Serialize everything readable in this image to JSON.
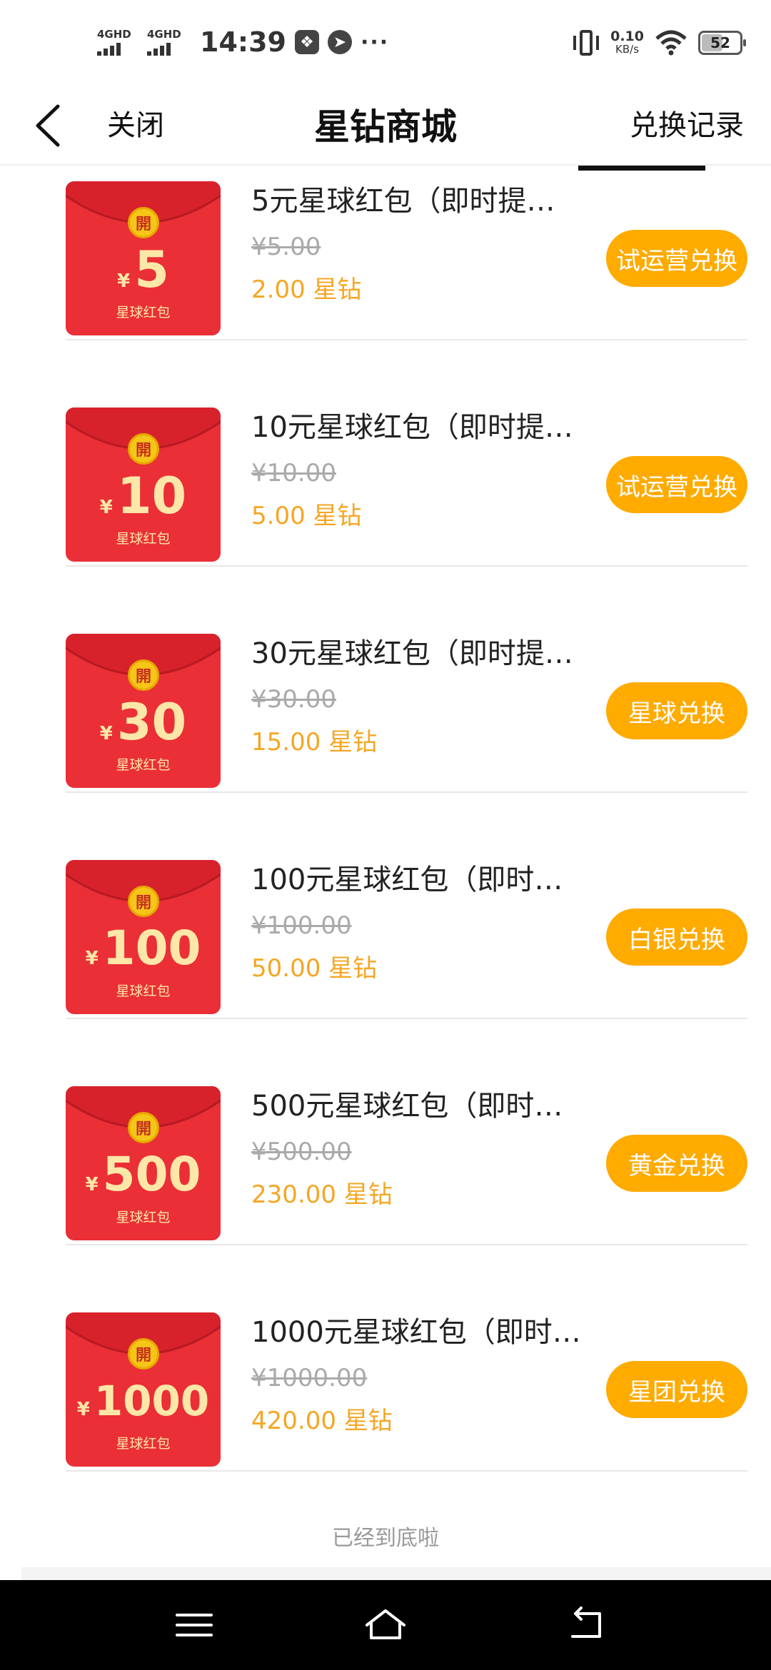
{
  "status_bar": {
    "network1": "4GHD",
    "network2": "4GHD",
    "time": "14:39",
    "more": "···",
    "speed_value": "0.10",
    "speed_unit": "KB/s",
    "battery": "52"
  },
  "nav": {
    "close_label": "关闭",
    "title": "星钻商城",
    "records_label": "兑换记录"
  },
  "envelope_coin_char": "開",
  "envelope_caption": "星球红包",
  "currency_symbol": "¥",
  "items": [
    {
      "amount": "5",
      "name": "5元星球红包（即时提…",
      "original_price": "¥5.00",
      "price": "2.00 星钻",
      "button": "试运营兑换"
    },
    {
      "amount": "10",
      "name": "10元星球红包（即时提…",
      "original_price": "¥10.00",
      "price": "5.00 星钻",
      "button": "试运营兑换"
    },
    {
      "amount": "30",
      "name": "30元星球红包（即时提…",
      "original_price": "¥30.00",
      "price": "15.00 星钻",
      "button": "星球兑换"
    },
    {
      "amount": "100",
      "name": "100元星球红包（即时…",
      "original_price": "¥100.00",
      "price": "50.00 星钻",
      "button": "白银兑换"
    },
    {
      "amount": "500",
      "name": "500元星球红包（即时…",
      "original_price": "¥500.00",
      "price": "230.00 星钻",
      "button": "黄金兑换"
    },
    {
      "amount": "1000",
      "name": "1000元星球红包（即时…",
      "original_price": "¥1000.00",
      "price": "420.00 星钻",
      "button": "星团兑换"
    }
  ],
  "footer_tip": "已经到底啦",
  "colors": {
    "accent_orange": "#ffab00",
    "price_orange": "#f5a623",
    "envelope_red": "#ea2f36"
  }
}
